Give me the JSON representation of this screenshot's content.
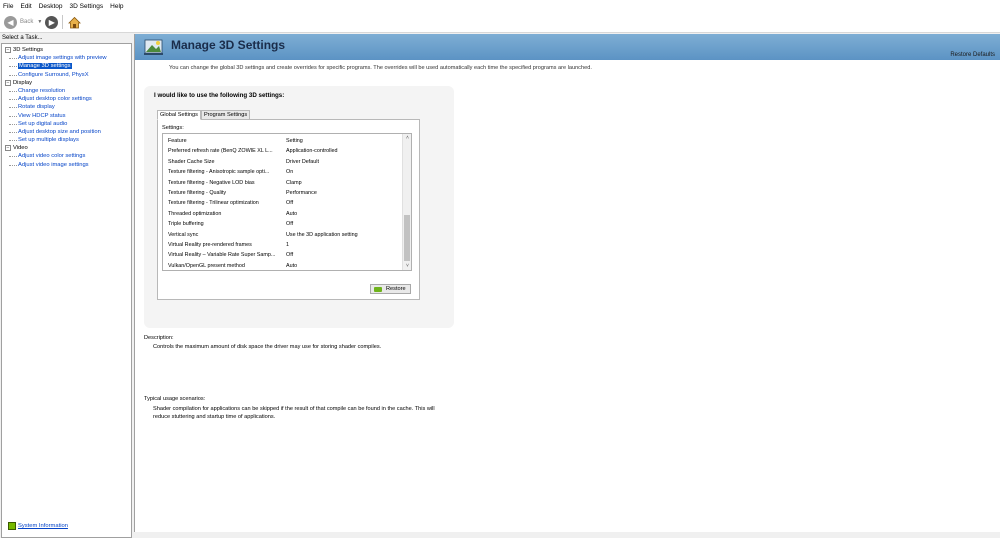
{
  "menu": [
    "File",
    "Edit",
    "Desktop",
    "3D Settings",
    "Help"
  ],
  "toolbar": {
    "back_label": "Back"
  },
  "sidebar": {
    "task_label": "Select a Task...",
    "categories": [
      {
        "label": "3D Settings",
        "items": [
          "Adjust image settings with preview",
          "Manage 3D settings",
          "Configure Surround, PhysX"
        ]
      },
      {
        "label": "Display",
        "items": [
          "Change resolution",
          "Adjust desktop color settings",
          "Rotate display",
          "View HDCP status",
          "Set up digital audio",
          "Adjust desktop size and position",
          "Set up multiple displays"
        ]
      },
      {
        "label": "Video",
        "items": [
          "Adjust video color settings",
          "Adjust video image settings"
        ]
      }
    ],
    "system_info": "System Information"
  },
  "page": {
    "title": "Manage 3D Settings",
    "restore_defaults": "Restore Defaults",
    "intro": "You can change the global 3D settings and create overrides for specific programs. The overrides will be used automatically each time the specified programs are launched.",
    "panel_heading": "I would like to use the following 3D settings:",
    "tabs": [
      "Global Settings",
      "Program Settings"
    ],
    "settings_label": "Settings:",
    "columns": {
      "feature": "Feature",
      "setting": "Setting"
    },
    "rows": [
      [
        "Preferred refresh rate (BenQ ZOWIE XL L...",
        "Application-controlled"
      ],
      [
        "Shader Cache Size",
        "Driver Default"
      ],
      [
        "Texture filtering - Anisotropic sample opti...",
        "On"
      ],
      [
        "Texture filtering - Negative LOD bias",
        "Clamp"
      ],
      [
        "Texture filtering - Quality",
        "Performance"
      ],
      [
        "Texture filtering - Trilinear optimization",
        "Off"
      ],
      [
        "Threaded optimization",
        "Auto"
      ],
      [
        "Triple buffering",
        "Off"
      ],
      [
        "Vertical sync",
        "Use the 3D application setting"
      ],
      [
        "Virtual Reality pre-rendered frames",
        "1"
      ],
      [
        "Virtual Reality – Variable Rate Super Samp...",
        "Off"
      ],
      [
        "Vulkan/OpenGL present method",
        "Auto"
      ]
    ],
    "restore_button": "Restore",
    "description_label": "Description:",
    "description_text": "Controls the maximum amount of disk space the driver may use for storing shader compiles.",
    "usage_label": "Typical usage scenarios:",
    "usage_text": "Shader compilation for applications can be skipped if the result of that compile can be found in the cache. This will reduce stuttering and startup time of applications."
  }
}
